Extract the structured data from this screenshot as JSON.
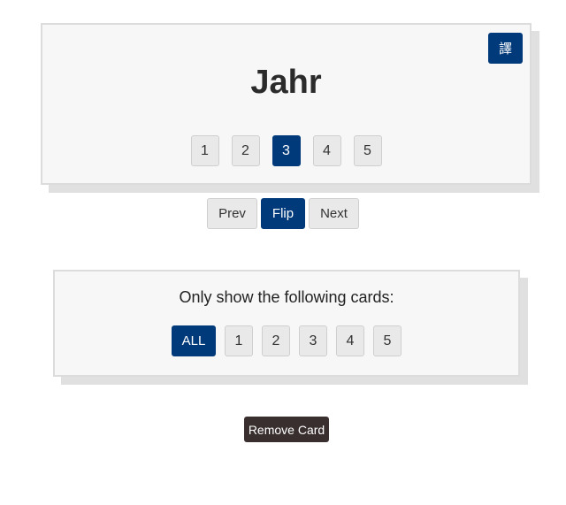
{
  "card": {
    "word": "Jahr",
    "translate_icon": "譯",
    "translate_icon_name": "translate-icon",
    "sides": [
      "1",
      "2",
      "3",
      "4",
      "5"
    ],
    "active_side": "3"
  },
  "controls": {
    "prev": "Prev",
    "flip": "Flip",
    "next": "Next"
  },
  "filter": {
    "title": "Only show the following cards:",
    "options": [
      "ALL",
      "1",
      "2",
      "3",
      "4",
      "5"
    ],
    "active": "ALL"
  },
  "remove_label": "Remove Card",
  "colors": {
    "accent": "#003a7a",
    "remove": "#3a2f2f",
    "panel": "#f7f7f7"
  }
}
